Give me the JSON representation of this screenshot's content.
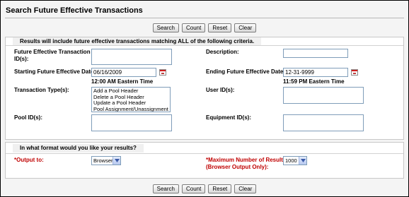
{
  "page": {
    "title": "Search Future Effective Transactions"
  },
  "buttons": {
    "search": "Search",
    "count": "Count",
    "reset": "Reset",
    "clear": "Clear"
  },
  "criteria": {
    "legend": "Results will include future effective transactions matching ALL of the following criteria.",
    "transaction_ids_label": "Future Effective Transaction ID(s):",
    "transaction_ids_value": "",
    "description_label": "Description:",
    "description_value": "",
    "start_date_label": "Starting Future Effective Date:",
    "start_date_value": "06/16/2009",
    "start_time": "12:00 AM Eastern Time",
    "end_date_label": "Ending Future Effective Date:",
    "end_date_value": "12-31-9999",
    "end_time": "11:59 PM Eastern Time",
    "transaction_types_label": "Transaction Type(s):",
    "transaction_types": [
      "Add a Pool Header",
      "Delete a Pool Header",
      "Update a Pool Header",
      "Pool Assignment/Unassignment"
    ],
    "user_ids_label": "User ID(s):",
    "user_ids_value": "",
    "pool_ids_label": "Pool ID(s):",
    "pool_ids_value": "",
    "equipment_ids_label": "Equipment ID(s):",
    "equipment_ids_value": ""
  },
  "format": {
    "legend": "In what format would you like your results?",
    "output_label": "*Output to:",
    "output_value": "Browser",
    "max_results_label_line1": "*Maximum Number of Results",
    "max_results_label_line2": "(Browser Output Only):",
    "max_results_value": "1000"
  },
  "colors": {
    "required_label": "#c00000",
    "panel_border": "#c8c8c8",
    "input_border": "#7f9db9"
  },
  "icons": {
    "calendar": "calendar-icon",
    "dropdown": "chevron-down-icon"
  }
}
